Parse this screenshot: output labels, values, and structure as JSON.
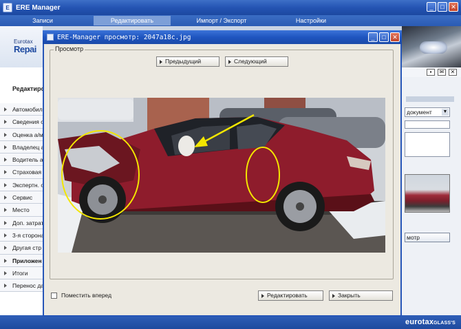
{
  "app": {
    "title": "ERE Manager",
    "menu": [
      "Записи",
      "Редактировать",
      "Импорт / Экспорт",
      "Настройки"
    ]
  },
  "logo": {
    "top": "Eurotax",
    "bottom": "Repai"
  },
  "sidebar": {
    "section_title": "Редактиро",
    "items": [
      {
        "label": "Автомобил",
        "bold": false
      },
      {
        "label": "Сведения о",
        "bold": false
      },
      {
        "label": "Оценка а/м",
        "bold": false
      },
      {
        "label": "Владелец а",
        "bold": false
      },
      {
        "label": "Водитель а",
        "bold": false
      },
      {
        "label": "Страховая",
        "bold": false
      },
      {
        "label": "Экспертн. о",
        "bold": false
      },
      {
        "label": "Сервис",
        "bold": false
      },
      {
        "label": "Место",
        "bold": false
      },
      {
        "label": "Доп. затрат",
        "bold": false
      },
      {
        "label": "3-я сторона",
        "bold": false
      },
      {
        "label": "Другая стр",
        "bold": false
      },
      {
        "label": "Приложен",
        "bold": true
      },
      {
        "label": "Итоги",
        "bold": false
      },
      {
        "label": "Перенос да",
        "bold": false
      }
    ]
  },
  "right_panel": {
    "select_value": "документ",
    "button_label": "мотр"
  },
  "brand": {
    "name": "eurotax",
    "suffix": "GLASS'S"
  },
  "dialog": {
    "title": "ERE-Manager просмотр: 2047a18c.jpg",
    "group_label": "Просмотр",
    "prev_label": "Предыдущий",
    "next_label": "Следующий",
    "checkbox_label": "Поместить вперед",
    "checkbox_checked": false,
    "edit_label": "Редактировать",
    "close_label": "Закрыть"
  },
  "colors": {
    "title_blue": "#2454b3",
    "dialog_bg": "#ece9e1",
    "car_red": "#8e1c2c",
    "annotation_yellow": "#f3e600"
  }
}
